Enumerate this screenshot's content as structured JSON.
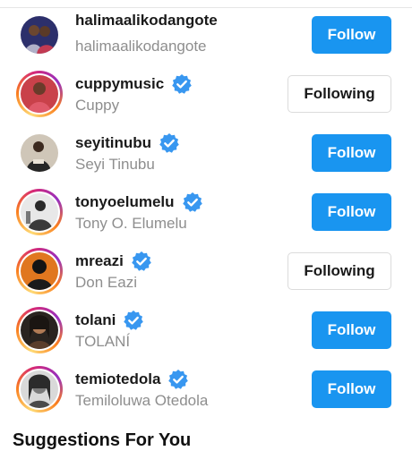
{
  "accounts": [
    {
      "username": "halimaalikodangote",
      "name": "halimaalikodangote",
      "verified": false,
      "button": "Follow",
      "ring": false
    },
    {
      "username": "cuppymusic",
      "name": "Cuppy",
      "verified": true,
      "button": "Following",
      "ring": true
    },
    {
      "username": "seyitinubu",
      "name": "Seyi Tinubu",
      "verified": true,
      "button": "Follow",
      "ring": false
    },
    {
      "username": "tonyoelumelu",
      "name": "Tony O. Elumelu",
      "verified": true,
      "button": "Follow",
      "ring": true
    },
    {
      "username": "mreazi",
      "name": "Don Eazi",
      "verified": true,
      "button": "Following",
      "ring": true
    },
    {
      "username": "tolani",
      "name": "TOLANÍ",
      "verified": true,
      "button": "Follow",
      "ring": true
    },
    {
      "username": "temiotedola",
      "name": "Temiloluwa Otedola",
      "verified": true,
      "button": "Follow",
      "ring": true
    }
  ],
  "section_title": "Suggestions For You",
  "colors": {
    "follow": "#1995f0",
    "verified": "#3897f0"
  }
}
